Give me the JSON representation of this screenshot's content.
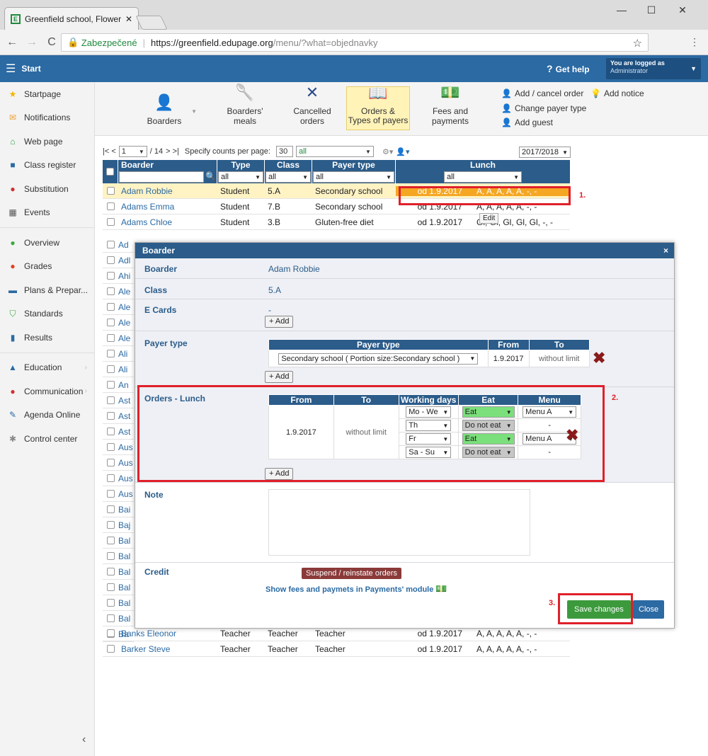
{
  "browser": {
    "tab_title": "Greenfield school, Flower",
    "secure_label": "Zabezpečené",
    "url_host": "https://greenfield.edupage.org",
    "url_path": "/menu/?what=objednavky"
  },
  "topnav": {
    "start": "Start",
    "help": "Get help",
    "logged_as": "You are logged as",
    "user": "Administrator"
  },
  "sidebar": [
    {
      "label": "Startpage",
      "icon": "star-icon",
      "color": "#f0b400"
    },
    {
      "label": "Notifications",
      "icon": "envelope-icon",
      "color": "#f0a030"
    },
    {
      "label": "Web page",
      "icon": "home-icon",
      "color": "#2a9d4a"
    },
    {
      "label": "Class register",
      "icon": "book-icon",
      "color": "#2b6aa3"
    },
    {
      "label": "Substitution",
      "icon": "substitution-icon",
      "color": "#d03030"
    },
    {
      "label": "Events",
      "icon": "calendar-icon",
      "color": "#555"
    },
    {
      "label": "Overview",
      "icon": "check-circle-icon",
      "color": "#3aaa3a"
    },
    {
      "label": "Grades",
      "icon": "grades-icon",
      "color": "#e04020"
    },
    {
      "label": "Plans & Prepar...",
      "icon": "plans-icon",
      "color": "#2b6aa3"
    },
    {
      "label": "Standards",
      "icon": "shield-icon",
      "color": "#3aaa3a"
    },
    {
      "label": "Results",
      "icon": "bar-chart-icon",
      "color": "#2b6aa3"
    },
    {
      "label": "Education",
      "icon": "education-icon",
      "color": "#2b6aa3"
    },
    {
      "label": "Communication",
      "icon": "chat-icon",
      "color": "#d03030"
    },
    {
      "label": "Agenda Online",
      "icon": "pen-icon",
      "color": "#2b6aa3"
    },
    {
      "label": "Control center",
      "icon": "gear-icon",
      "color": "#888"
    }
  ],
  "toolbar": {
    "boarders": "Boarders",
    "meals": "Boarders' meals",
    "cancelled": "Cancelled orders",
    "orders_types": "Orders &\nTypes of payers",
    "fees": "Fees and payments",
    "add_cancel": "Add / cancel order",
    "add_notice": "Add notice",
    "change_payer": "Change payer type",
    "add_guest": "Add guest"
  },
  "pager": {
    "first": "|< <",
    "page": "1",
    "total": "/ 14",
    "next": "> >|",
    "counts_label": "Specify counts per page:",
    "count": "30",
    "filter": "all",
    "year": "2017/2018"
  },
  "grid": {
    "headers": {
      "boarder": "Boarder",
      "type": "Type",
      "class": "Class",
      "payer": "Payer type",
      "lunch": "Lunch"
    },
    "filter_all": "all",
    "rows": [
      {
        "name": "Adam Robbie",
        "type": "Student",
        "cls": "5.A",
        "payer": "Secondary school",
        "from": "od 1.9.2017",
        "menu": "A, A, A, A, A, -, -"
      },
      {
        "name": "Adams Emma",
        "type": "Student",
        "cls": "7.B",
        "payer": "Secondary school",
        "from": "od 1.9.2017",
        "menu": "A, A, A, A, A, -, -"
      },
      {
        "name": "Adams Chloe",
        "type": "Student",
        "cls": "3.B",
        "payer": "Gluten-free diet",
        "from": "od 1.9.2017",
        "menu": "Gl, Gl, Gl, Gl, Gl, -, -"
      }
    ],
    "partial_rows": [
      "Ad",
      "Adl",
      "Ahi",
      "Ale",
      "Ale",
      "Ale",
      "Ale",
      "Ali",
      "Ali",
      "An",
      "Ast",
      "Ast",
      "Ast",
      "Aus",
      "Aus",
      "Aus",
      "Aus",
      "Bai",
      "Baj",
      "Bal",
      "Bal",
      "Bal",
      "Bal",
      "Bal",
      "Bal",
      "Ba"
    ],
    "bottom_rows": [
      {
        "name": "Banks Eleonor",
        "type": "Teacher",
        "cls": "Teacher",
        "payer": "Teacher",
        "from": "od 1.9.2017",
        "menu": "A, A, A, A, A, -, -"
      },
      {
        "name": "Barker Steve",
        "type": "Teacher",
        "cls": "Teacher",
        "payer": "Teacher",
        "from": "od 1.9.2017",
        "menu": "A, A, A, A, A, -, -"
      }
    ],
    "tooltip": "Edit"
  },
  "labels": {
    "one": "1.",
    "two": "2.",
    "three": "3."
  },
  "modal": {
    "title": "Boarder",
    "close": "×",
    "boarder_label": "Boarder",
    "boarder_value": "Adam Robbie",
    "class_label": "Class",
    "class_value": "5.A",
    "ecards_label": "E Cards",
    "ecards_value": "-",
    "add": "+ Add",
    "payer_label": "Payer type",
    "payer_table": {
      "h_payer": "Payer type",
      "h_from": "From",
      "h_to": "To",
      "payer": "Secondary school ( Portion size:Secondary school )",
      "from": "1.9.2017",
      "to": "without limit"
    },
    "orders_label": "Orders - Lunch",
    "orders_table": {
      "h_from": "From",
      "h_to": "To",
      "h_days": "Working days",
      "h_eat": "Eat",
      "h_menu": "Menu",
      "from": "1.9.2017",
      "to": "without limit",
      "rows": [
        {
          "days": "Mo - We",
          "eat": "Eat",
          "menu": "Menu A"
        },
        {
          "days": "Th",
          "eat": "Do not eat",
          "menu": "-"
        },
        {
          "days": "Fr",
          "eat": "Eat",
          "menu": "Menu A"
        },
        {
          "days": "Sa - Su",
          "eat": "Do not eat",
          "menu": "-"
        }
      ]
    },
    "note_label": "Note",
    "credit_label": "Credit",
    "suspend": "Suspend / reinstate orders",
    "show_fees": "Show fees and paymets in Payments' module",
    "save": "Save changes",
    "close_btn": "Close"
  }
}
